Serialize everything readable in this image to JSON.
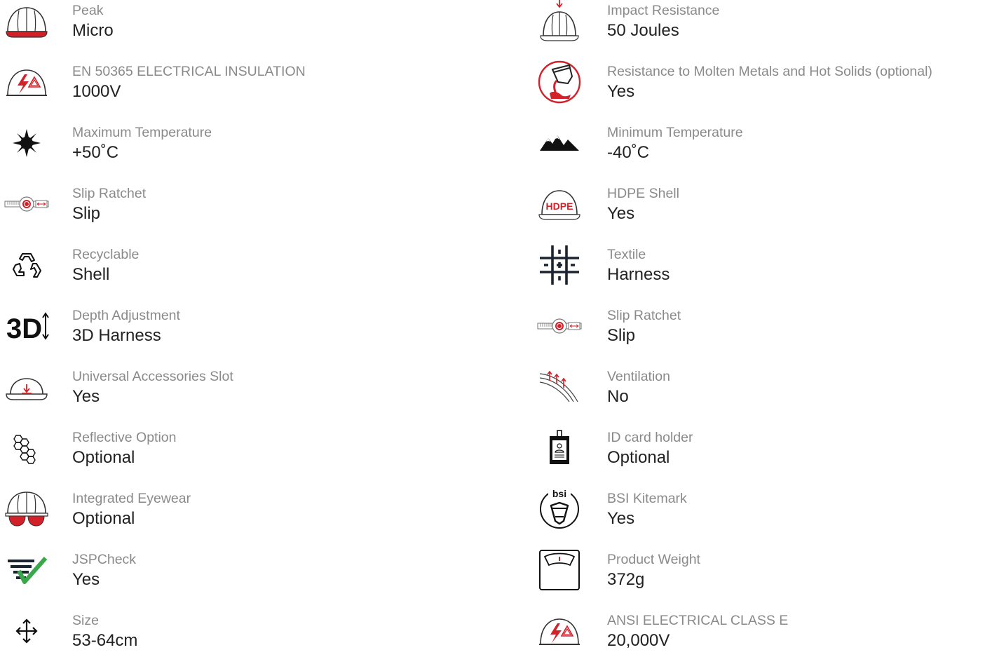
{
  "colors": {
    "label": "#8a8a8a",
    "value": "#222222",
    "accent_red": "#d3212a",
    "accent_green": "#3aa84a",
    "icon_dark": "#1c2430"
  },
  "left_specs": [
    {
      "label": "Peak",
      "value": "Micro",
      "icon": "helmet-red-peak-icon"
    },
    {
      "label": "EN 50365 ELECTRICAL INSULATION",
      "value": "1000V",
      "icon": "electrical-insulation-icon"
    },
    {
      "label": "Maximum Temperature",
      "value": "+50˚C",
      "icon": "sun-icon"
    },
    {
      "label": "Slip Ratchet",
      "value": "Slip",
      "icon": "slip-ratchet-icon"
    },
    {
      "label": "Recyclable",
      "value": "Shell",
      "icon": "recycle-icon"
    },
    {
      "label": "Depth Adjustment",
      "value": "3D Harness",
      "icon": "3d-depth-icon"
    },
    {
      "label": "Universal Accessories Slot",
      "value": "Yes",
      "icon": "accessory-slot-icon"
    },
    {
      "label": "Reflective Option",
      "value": "Optional",
      "icon": "reflective-hexagon-icon"
    },
    {
      "label": "Integrated Eyewear",
      "value": "Optional",
      "icon": "helmet-eyewear-icon"
    },
    {
      "label": "JSPCheck",
      "value": "Yes",
      "icon": "jspcheck-icon"
    },
    {
      "label": "Size",
      "value": "53-64cm",
      "icon": "size-arrows-icon"
    }
  ],
  "right_specs": [
    {
      "label": "Impact Resistance",
      "value": "50 Joules",
      "icon": "impact-helmet-icon"
    },
    {
      "label": "Resistance to Molten Metals and Hot Solids (optional)",
      "value": "Yes",
      "icon": "molten-metal-icon"
    },
    {
      "label": "Minimum Temperature",
      "value": "-40˚C",
      "icon": "mountains-icon"
    },
    {
      "label": "HDPE Shell",
      "value": "Yes",
      "icon": "hdpe-helmet-icon"
    },
    {
      "label": "Textile",
      "value": "Harness",
      "icon": "textile-weave-icon"
    },
    {
      "label": "Slip Ratchet",
      "value": "Slip",
      "icon": "slip-ratchet-icon"
    },
    {
      "label": "Ventilation",
      "value": "No",
      "icon": "ventilation-icon"
    },
    {
      "label": "ID card holder",
      "value": "Optional",
      "icon": "id-card-icon"
    },
    {
      "label": "BSI Kitemark",
      "value": "Yes",
      "icon": "bsi-kitemark-icon",
      "icon_text": "bsi"
    },
    {
      "label": "Product Weight",
      "value": "372g",
      "icon": "weighing-scale-icon"
    },
    {
      "label": "ANSI ELECTRICAL CLASS E",
      "value": "20,000V",
      "icon": "electrical-class-icon"
    }
  ],
  "icon_text": {
    "hdpe": "HDPE",
    "three_d": "3D"
  }
}
